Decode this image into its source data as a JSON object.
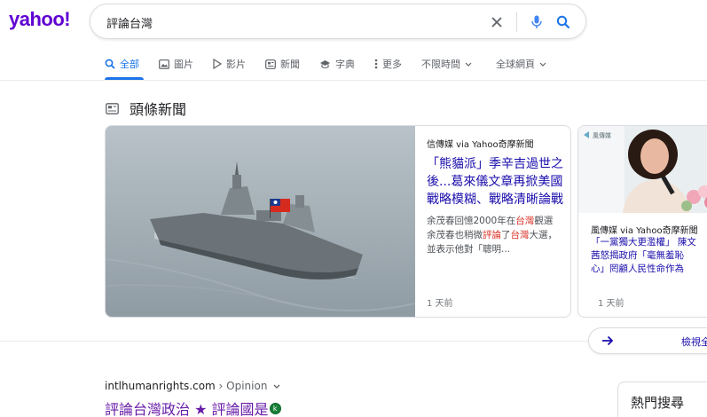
{
  "brand": {
    "logo": "yahoo!"
  },
  "search": {
    "query": "評論台灣",
    "placeholder": ""
  },
  "tabs": [
    {
      "label": "全部",
      "icon": "search-icon",
      "active": true
    },
    {
      "label": "圖片",
      "icon": "image-icon"
    },
    {
      "label": "影片",
      "icon": "play-icon"
    },
    {
      "label": "新聞",
      "icon": "news-icon"
    },
    {
      "label": "字典",
      "icon": "dictionary-icon"
    },
    {
      "label": "更多",
      "icon": "more-icon"
    },
    {
      "label": "不限時間"
    },
    {
      "label": "全球網頁"
    }
  ],
  "news_section": {
    "title": "頭條新聞"
  },
  "cards": [
    {
      "source": "信傳媒 via Yahoo奇摩新聞",
      "headline": "「熊貓派」季辛吉過世之後...葛來儀文章再掀美國戰略模糊、戰略清晰論戰",
      "snippet_parts": [
        "余茂春回憶2000年在",
        "台灣",
        "觀選 余茂春也稍微",
        "評論",
        "了",
        "台灣",
        "大選，並表示他對「聰明..."
      ],
      "time": "1 天前"
    },
    {
      "source": "風傳媒 via Yahoo奇摩新聞",
      "headline_lines": [
        "「一黨獨大更濫權」 陳文",
        "茜怒揭政府「毫無羞恥",
        "心」罔顧人民性命作為"
      ],
      "image_text": "風傳媒",
      "time": "1 天前"
    }
  ],
  "view_all": {
    "label": "檢視全部"
  },
  "result": {
    "domain": "intlhumanrights.com",
    "breadcrumb": " › Opinion",
    "title": "評論台灣政治 ★ 評論國是"
  },
  "trending": {
    "title": "熱門搜尋"
  },
  "colors": {
    "brand": "#6001d2",
    "link": "#1a0dab",
    "visited": "#681da8",
    "accent": "#1a73e8",
    "highlight": "#d93025"
  }
}
